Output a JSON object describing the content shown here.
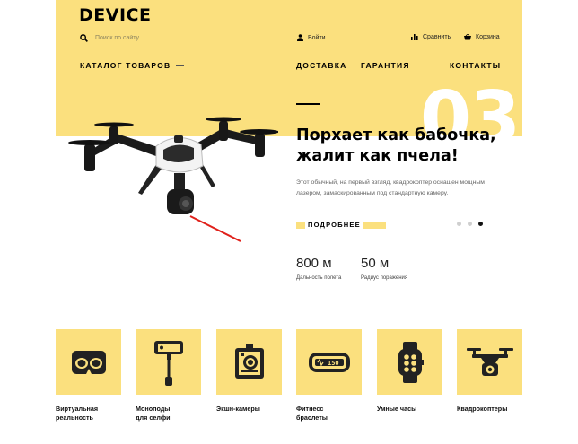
{
  "brand": {
    "logo": "DEVICE",
    "accent_color": "#fbe07e"
  },
  "search": {
    "placeholder": "Поиск по сайту"
  },
  "top_links": {
    "login": "Войти",
    "compare": "Сравнить",
    "cart": "Корзина"
  },
  "nav": {
    "catalog": "КАТАЛОГ ТОВАРОВ",
    "delivery": "ДОСТАВКА",
    "warranty": "ГАРАНТИЯ",
    "contacts": "КОНТАКТЫ"
  },
  "slide": {
    "number": "03",
    "headline": "Порхает как бабочка, жалит как пчела!",
    "description": "Этот обычный, на первый взгляд, квадрокоптер оснащен мощным лазером, замаскированным под стандартную камеру.",
    "more_button": "ПОДРОБНЕЕ",
    "total_slides": 3,
    "active_slide": 3
  },
  "stats": [
    {
      "value": "800 м",
      "label": "Дальность полета"
    },
    {
      "value": "50 м",
      "label": "Радиус поражения"
    }
  ],
  "categories": [
    {
      "line1": "Виртуальная",
      "line2": "реальность",
      "icon": "vr-headset-icon"
    },
    {
      "line1": "Моноподы",
      "line2": "для селфи",
      "icon": "selfie-stick-icon"
    },
    {
      "line1": "Экшн-камеры",
      "line2": "",
      "icon": "action-camera-icon"
    },
    {
      "line1": "Фитнесс",
      "line2": "браслеты",
      "icon": "fitness-band-icon",
      "display": "150"
    },
    {
      "line1": "Умные часы",
      "line2": "",
      "icon": "smart-watch-icon"
    },
    {
      "line1": "Квадрокоптеры",
      "line2": "",
      "icon": "quadcopter-icon"
    }
  ]
}
